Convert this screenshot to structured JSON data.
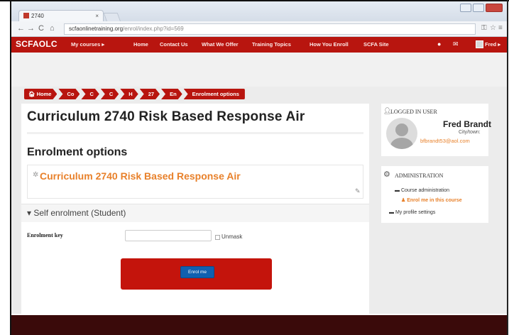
{
  "browser": {
    "tab_title": "2740",
    "tab_close": "×",
    "url_host": "scfaonlinetraining.org",
    "url_path": "/enrol/index.php?id=569",
    "back_icon": "arrow-left-icon",
    "forward_icon": "arrow-right-icon",
    "reload_icon": "reload-icon",
    "home_icon": "home-icon"
  },
  "nav": {
    "brand": "SCFAOLC",
    "items": [
      "My courses ▸",
      "Home",
      "Contact Us",
      "What We Offer",
      "Training Topics",
      "How You Enroll",
      "SCFA Site"
    ],
    "user": "Fred ▸"
  },
  "breadcrumb": [
    "Home",
    "Co",
    "C",
    "C",
    "H",
    "27",
    "En",
    "Enrolment options"
  ],
  "main": {
    "title": "Curriculum 2740 Risk Based Response Air",
    "enrol_heading": "Enrolment options",
    "course_name": "Curriculum 2740 Risk Based Response Air",
    "self_enrol": "Self enrolment (Student)",
    "enrol_key_label": "Enrolment key",
    "enrol_key_value": "",
    "unmask_label": "Unmask",
    "enrol_button": "Enrol me"
  },
  "logged_in": {
    "title": "LOGGED IN USER",
    "name": "Fred Brandt",
    "city": "City/town:",
    "email": "bfbrandt53@aol.com"
  },
  "admin": {
    "title": "ADMINISTRATION",
    "items": [
      "Course administration",
      "Enrol me in this course",
      "My profile settings"
    ]
  },
  "colors": {
    "accent_red": "#b8150f",
    "link_orange": "#e8812b",
    "button_blue": "#1060b0"
  }
}
